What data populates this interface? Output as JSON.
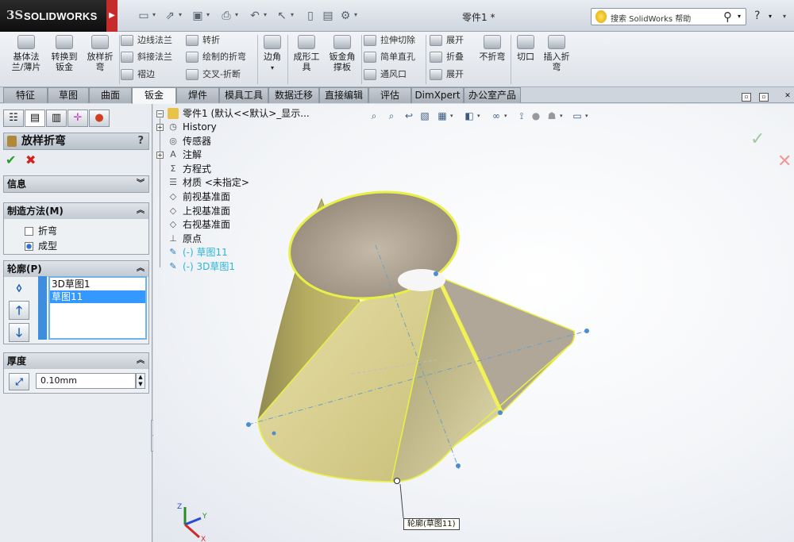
{
  "app": {
    "brand_mark": "3S",
    "brand_name": "SOLIDWORKS",
    "doc_title": "零件1 *"
  },
  "search": {
    "placeholder": "搜索 SolidWorks 帮助"
  },
  "help_label": "?",
  "ribbon": {
    "big": [
      {
        "id": "base-flange",
        "label1": "基体法",
        "label2": "兰/薄片"
      },
      {
        "id": "convert",
        "label1": "转换到",
        "label2": "钣金"
      },
      {
        "id": "loft-bend",
        "label1": "放样折",
        "label2": "弯"
      },
      {
        "id": "corner",
        "label1": "边角",
        "label2": ""
      },
      {
        "id": "form-tool",
        "label1": "成形工",
        "label2": "具"
      },
      {
        "id": "gusset",
        "label1": "钣金角",
        "label2": "撑板"
      },
      {
        "id": "no-bends",
        "label1": "不折弯",
        "label2": ""
      },
      {
        "id": "rip",
        "label1": "切口",
        "label2": ""
      },
      {
        "id": "insert-bends",
        "label1": "插入折",
        "label2": "弯"
      }
    ],
    "small": [
      {
        "id": "edge-flange",
        "label": "边线法兰"
      },
      {
        "id": "miter-flange",
        "label": "斜接法兰"
      },
      {
        "id": "hem",
        "label": "褶边"
      },
      {
        "id": "jog",
        "label": "转折"
      },
      {
        "id": "sketched-bend",
        "label": "绘制的折弯"
      },
      {
        "id": "cross-break",
        "label": "交叉-折断"
      },
      {
        "id": "extruded-cut",
        "label": "拉伸切除"
      },
      {
        "id": "simple-hole",
        "label": "简单直孔"
      },
      {
        "id": "vent",
        "label": "通风口"
      },
      {
        "id": "unfold",
        "label": "展开"
      },
      {
        "id": "fold",
        "label": "折叠"
      },
      {
        "id": "flatten",
        "label": "展开"
      }
    ]
  },
  "tabs": [
    "特征",
    "草图",
    "曲面",
    "钣金",
    "焊件",
    "模具工具",
    "数据迁移",
    "直接编辑",
    "评估",
    "DimXpert",
    "办公室产品"
  ],
  "active_tab": "钣金",
  "property_manager": {
    "title": "放样折弯",
    "help": "?",
    "ok": "✔",
    "cancel": "✖",
    "sections": {
      "info": {
        "title": "信息"
      },
      "method": {
        "title": "制造方法(M)",
        "options": [
          {
            "label": "折弯",
            "checked": false
          },
          {
            "label": "成型",
            "checked": true
          }
        ]
      },
      "profiles": {
        "title": "轮廓(P)",
        "items": [
          "3D草图1",
          "草图11"
        ],
        "selected": "草图11"
      },
      "thickness": {
        "title": "厚度",
        "value": "0.10mm"
      }
    }
  },
  "tree": {
    "root": "零件1 (默认<<默认>_显示...",
    "items": [
      {
        "label": "History",
        "expandable": true,
        "icon": "history-icon"
      },
      {
        "label": "传感器",
        "expandable": false,
        "icon": "sensor-icon"
      },
      {
        "label": "注解",
        "expandable": true,
        "icon": "annotation-icon"
      },
      {
        "label": "方程式",
        "expandable": false,
        "icon": "equation-icon"
      },
      {
        "label": "材质 <未指定>",
        "expandable": false,
        "icon": "material-icon"
      },
      {
        "label": "前视基准面",
        "expandable": false,
        "icon": "plane-icon"
      },
      {
        "label": "上视基准面",
        "expandable": false,
        "icon": "plane-icon"
      },
      {
        "label": "右视基准面",
        "expandable": false,
        "icon": "plane-icon"
      },
      {
        "label": "原点",
        "expandable": false,
        "icon": "origin-icon"
      },
      {
        "label": "(-) 草图11",
        "expandable": false,
        "icon": "sketch-icon",
        "highlight": true
      },
      {
        "label": "(-) 3D草图1",
        "expandable": false,
        "icon": "3d-sketch-icon",
        "highlight": true
      }
    ]
  },
  "callout": "轮廓(草图11)",
  "triad": {
    "x": "X",
    "y": "Y",
    "z": "Z"
  },
  "colors": {
    "part_body": "#b3a34a",
    "edge_highlight": "#e8f047",
    "selection": "#3399ff",
    "accent_red": "#c62b2b"
  }
}
